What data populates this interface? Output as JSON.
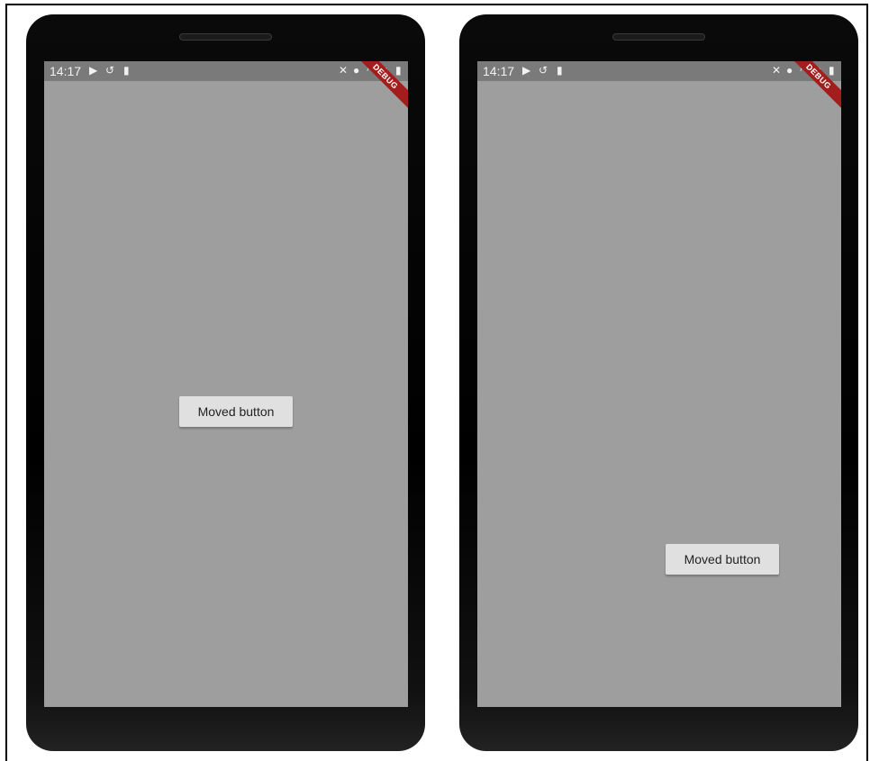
{
  "phones": [
    {
      "status_bar": {
        "time": "14:17",
        "left_icons": [
          "play-store-icon",
          "no-sync-icon",
          "sd-card-icon"
        ],
        "right_icons": [
          "mute-icon",
          "location-icon",
          "wifi-icon",
          "signal-icon",
          "battery-icon"
        ]
      },
      "debug_banner": "DEBUG",
      "button_label": "Moved button"
    },
    {
      "status_bar": {
        "time": "14:17",
        "left_icons": [
          "play-store-icon",
          "no-sync-icon",
          "sd-card-icon"
        ],
        "right_icons": [
          "mute-icon",
          "location-icon",
          "wifi-icon",
          "signal-icon",
          "battery-icon"
        ]
      },
      "debug_banner": "DEBUG",
      "button_label": "Moved button"
    }
  ],
  "colors": {
    "screen_background": "#9e9e9e",
    "status_bar": "#7a7a7a",
    "debug_banner": "#a41d1d",
    "button_background": "#e0e0e0"
  }
}
